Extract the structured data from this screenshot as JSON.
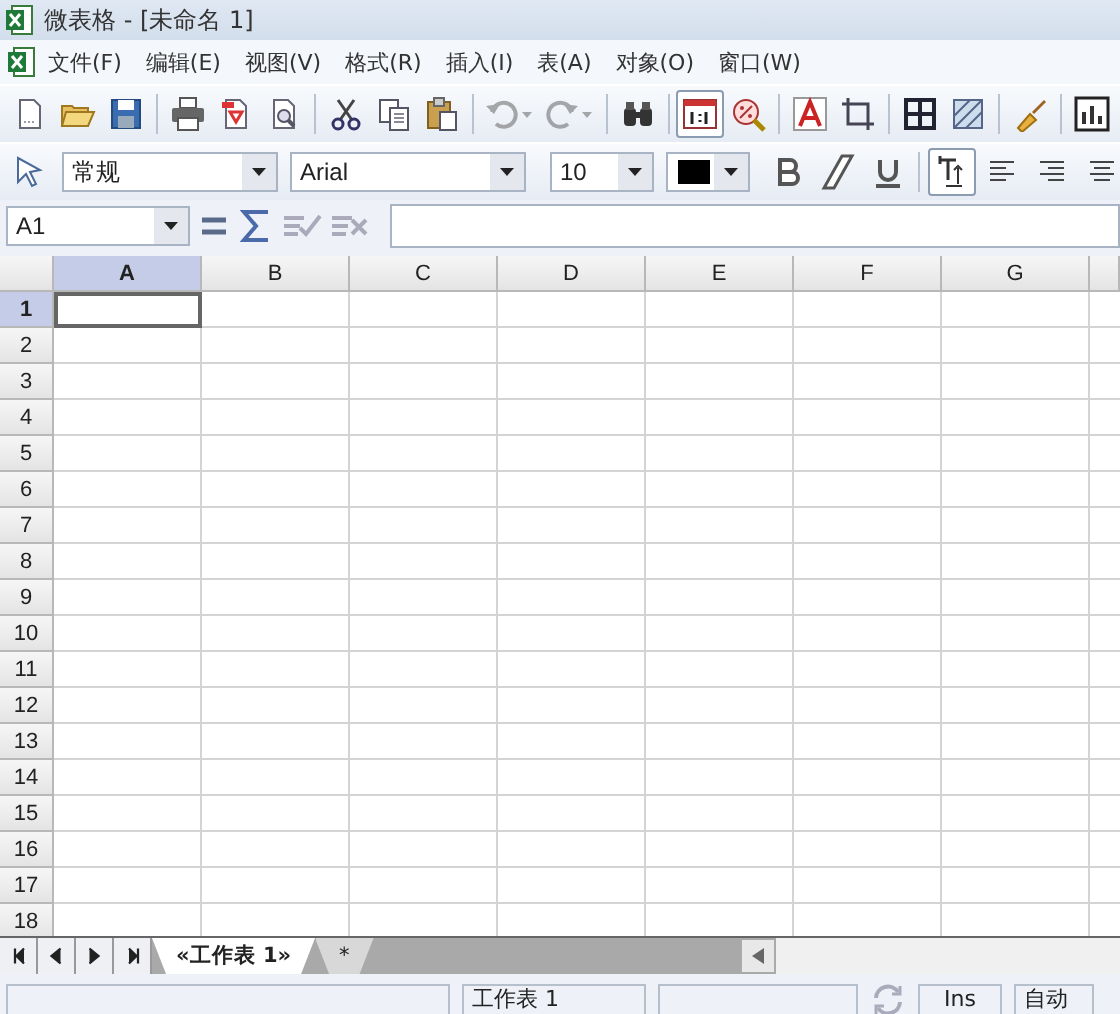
{
  "window": {
    "title": "微表格 - [未命名 1]"
  },
  "menu": [
    {
      "label": "文件(F)"
    },
    {
      "label": "编辑(E)"
    },
    {
      "label": "视图(V)"
    },
    {
      "label": "格式(R)"
    },
    {
      "label": "插入(I)"
    },
    {
      "label": "表(A)"
    },
    {
      "label": "对象(O)"
    },
    {
      "label": "窗口(W)"
    }
  ],
  "toolbar": [
    {
      "kind": "new",
      "pressed": false,
      "disabled": false
    },
    {
      "kind": "open",
      "pressed": false,
      "disabled": false
    },
    {
      "kind": "save",
      "pressed": false,
      "disabled": false
    },
    {
      "kind": "separator"
    },
    {
      "kind": "print",
      "pressed": false,
      "disabled": false
    },
    {
      "kind": "pdf",
      "pressed": false,
      "disabled": false
    },
    {
      "kind": "preview",
      "pressed": false,
      "disabled": false
    },
    {
      "kind": "separator"
    },
    {
      "kind": "cut",
      "pressed": false,
      "disabled": false
    },
    {
      "kind": "copy",
      "pressed": false,
      "disabled": false
    },
    {
      "kind": "paste",
      "pressed": false,
      "disabled": false
    },
    {
      "kind": "separator"
    },
    {
      "kind": "undo",
      "pressed": false,
      "disabled": true
    },
    {
      "kind": "redo",
      "pressed": false,
      "disabled": true
    },
    {
      "kind": "separator"
    },
    {
      "kind": "find",
      "pressed": false,
      "disabled": false
    },
    {
      "kind": "separator"
    },
    {
      "kind": "zoom100",
      "pressed": true,
      "disabled": false
    },
    {
      "kind": "zoom",
      "pressed": false,
      "disabled": false
    },
    {
      "kind": "separator"
    },
    {
      "kind": "textcolor",
      "pressed": false,
      "disabled": false
    },
    {
      "kind": "crop",
      "pressed": false,
      "disabled": false
    },
    {
      "kind": "separator"
    },
    {
      "kind": "borders",
      "pressed": false,
      "disabled": false
    },
    {
      "kind": "hatch",
      "pressed": false,
      "disabled": false
    },
    {
      "kind": "separator"
    },
    {
      "kind": "brush",
      "pressed": false,
      "disabled": false
    },
    {
      "kind": "separator"
    },
    {
      "kind": "chart",
      "pressed": false,
      "disabled": false
    }
  ],
  "format_bar": {
    "style": "常规",
    "font": "Arial",
    "size": "10",
    "buttons": [
      {
        "kind": "bold",
        "pressed": false
      },
      {
        "kind": "italic",
        "pressed": false
      },
      {
        "kind": "underline",
        "pressed": false
      },
      {
        "kind": "separator"
      },
      {
        "kind": "wrap",
        "pressed": true
      },
      {
        "kind": "align-left",
        "pressed": false
      },
      {
        "kind": "align-right",
        "pressed": false
      },
      {
        "kind": "align-center",
        "pressed": false
      }
    ]
  },
  "formula_bar": {
    "cell_ref": "A1"
  },
  "sheet": {
    "columns": [
      {
        "label": "A",
        "selected": true
      },
      {
        "label": "B",
        "selected": false
      },
      {
        "label": "C",
        "selected": false
      },
      {
        "label": "D",
        "selected": false
      },
      {
        "label": "E",
        "selected": false
      },
      {
        "label": "F",
        "selected": false
      },
      {
        "label": "G",
        "selected": false
      }
    ],
    "rows": [
      {
        "label": "1",
        "selected": true
      },
      {
        "label": "2",
        "selected": false
      },
      {
        "label": "3",
        "selected": false
      },
      {
        "label": "4",
        "selected": false
      },
      {
        "label": "5",
        "selected": false
      },
      {
        "label": "6",
        "selected": false
      },
      {
        "label": "7",
        "selected": false
      },
      {
        "label": "8",
        "selected": false
      },
      {
        "label": "9",
        "selected": false
      },
      {
        "label": "10",
        "selected": false
      },
      {
        "label": "11",
        "selected": false
      },
      {
        "label": "12",
        "selected": false
      },
      {
        "label": "13",
        "selected": false
      },
      {
        "label": "14",
        "selected": false
      },
      {
        "label": "15",
        "selected": false
      },
      {
        "label": "16",
        "selected": false
      },
      {
        "label": "17",
        "selected": false
      },
      {
        "label": "18",
        "selected": false
      }
    ]
  },
  "sheet_tabs": [
    {
      "label": "«工作表 1»",
      "selected": true
    },
    {
      "label": "*",
      "selected": false
    }
  ],
  "status_bar": {
    "sheet": "工作表 1",
    "mode": "Ins",
    "calc": "自动"
  }
}
